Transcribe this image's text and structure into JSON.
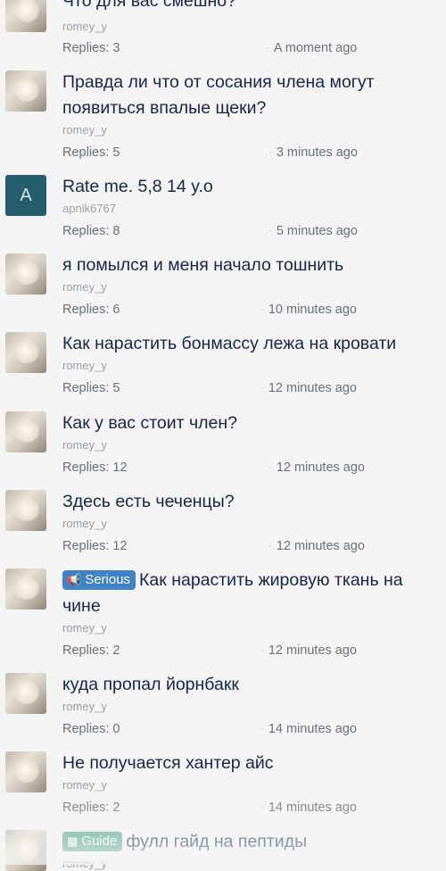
{
  "threads": [
    {
      "title": "Что для вас смешно?",
      "author": "romey_y",
      "replies": "Replies: 3",
      "time": "A moment ago",
      "avatar": "dog"
    },
    {
      "title": "Правда ли что от сосания члена могут появиться впалые щеки?",
      "author": "romey_y",
      "replies": "Replies: 5",
      "time": "3 minutes ago",
      "avatar": "dog"
    },
    {
      "title": "Rate me. 5,8 14 y.o",
      "author": "apnik6767",
      "replies": "Replies: 8",
      "time": "5 minutes ago",
      "avatar": "A"
    },
    {
      "title": "я помылся и меня начало тошнить",
      "author": "romey_y",
      "replies": "Replies: 6",
      "time": "10 minutes ago",
      "avatar": "dog"
    },
    {
      "title": "Как нарастить бонмассу лежа на кровати",
      "author": "romey_y",
      "replies": "Replies: 5",
      "time": "12 minutes ago",
      "avatar": "dog"
    },
    {
      "title": "Как у вас стоит член?",
      "author": "romey_y",
      "replies": "Replies: 12",
      "time": "12 minutes ago",
      "avatar": "dog"
    },
    {
      "title": "Здесь есть чеченцы?",
      "author": "romey_y",
      "replies": "Replies: 12",
      "time": "12 minutes ago",
      "avatar": "dog"
    },
    {
      "prefix": "Serious",
      "prefix_icon": "megaphone-icon",
      "title": "Как нарастить жировую ткань на чине",
      "author": "romey_y",
      "replies": "Replies: 2",
      "time": "12 minutes ago",
      "avatar": "dog"
    },
    {
      "title": "куда пропал йорнбакк",
      "author": "romey_y",
      "replies": "Replies: 0",
      "time": "14 minutes ago",
      "avatar": "dog"
    },
    {
      "title": "Не получается хантер айс",
      "author": "romey_y",
      "replies": "Replies: 2",
      "time": "14 minutes ago",
      "avatar": "dog"
    },
    {
      "prefix": "Guide",
      "prefix_icon": "document-icon",
      "title": "фулл гайд на пептиды",
      "author": "romey_y",
      "avatar": "dog"
    }
  ],
  "colors": {
    "serious_prefix": "#3f82c8",
    "guide_prefix": "#4ea38a",
    "letter_avatar": "#235e6a"
  }
}
